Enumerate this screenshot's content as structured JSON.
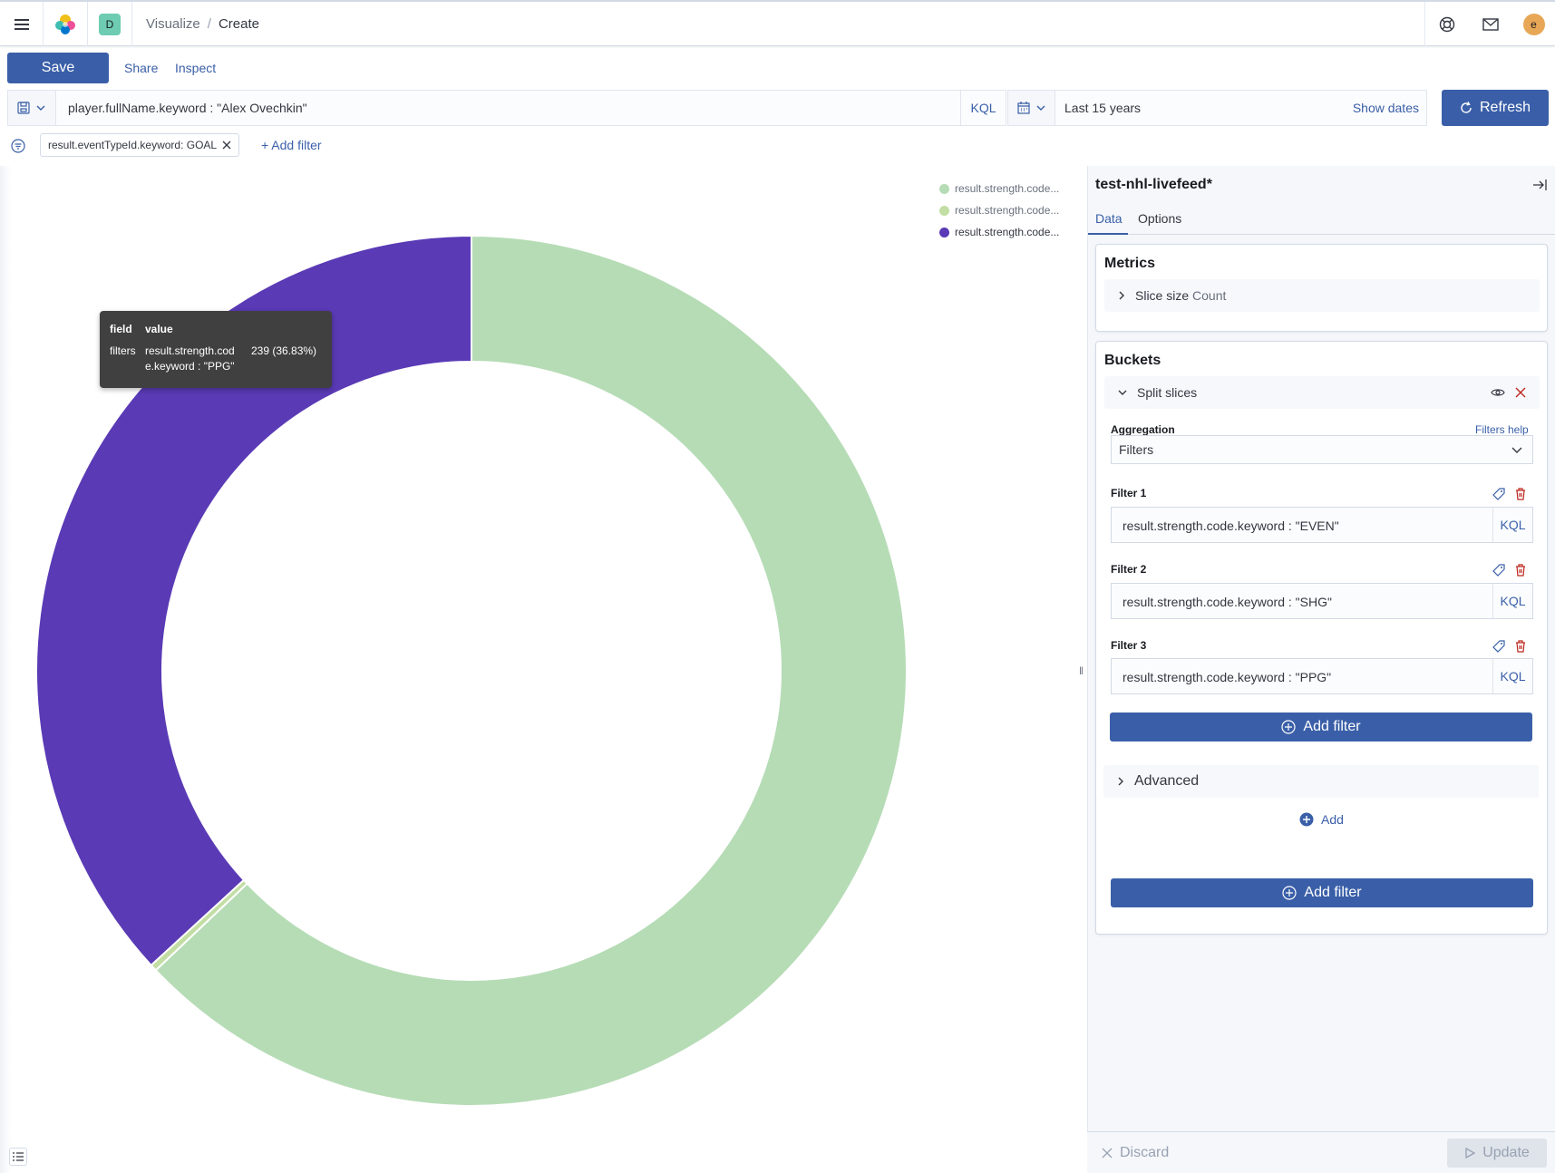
{
  "header": {
    "space_initial": "D",
    "breadcrumbs": [
      "Visualize",
      "Create"
    ],
    "breadcrumb_sep": "/",
    "avatar_initial": "e",
    "icons": {
      "menu": "hamburger-icon",
      "logo": "elastic-logo",
      "help": "help-icon",
      "mail": "mail-icon"
    }
  },
  "actions": {
    "save": "Save",
    "share": "Share",
    "inspect": "Inspect"
  },
  "query": {
    "text": "player.fullName.keyword : \"Alex Ovechkin\"",
    "language": "KQL"
  },
  "time": {
    "range": "Last 15 years",
    "show_dates": "Show dates",
    "refresh": "Refresh"
  },
  "filters": {
    "pills": [
      "result.eventTypeId.keyword: GOAL"
    ],
    "add_filter": "+ Add filter"
  },
  "chart_data": {
    "type": "pie",
    "donut": true,
    "legend_position": "top-right",
    "legend": [
      {
        "label": "result.strength.code...",
        "color": "#b6dcb6"
      },
      {
        "label": "result.strength.code...",
        "color": "#c3dea4"
      },
      {
        "label": "result.strength.code...",
        "color": "#5a3ab5"
      }
    ],
    "slices": [
      {
        "name": "result.strength.code.keyword : \"EVEN\"",
        "color": "#b6dcb6",
        "fraction": 0.6292
      },
      {
        "name": "result.strength.code.keyword : \"SHG\"",
        "color": "#c3dea4",
        "fraction": 0.0025
      },
      {
        "name": "result.strength.code.keyword : \"PPG\"",
        "value": 239,
        "percent": 36.83,
        "color": "#5a3ab5",
        "fraction": 0.3683
      }
    ]
  },
  "tooltip": {
    "header_field": "field",
    "header_value": "value",
    "field": "filters",
    "value_line1": "result.strength.cod",
    "value_line2": "e.keyword : \"PPG\"",
    "count": "239 (36.83%)"
  },
  "sidebar": {
    "index_pattern": "test-nhl-livefeed*",
    "tabs": [
      "Data",
      "Options"
    ],
    "metrics": {
      "title": "Metrics",
      "item_label": "Slice size",
      "item_value": "Count"
    },
    "buckets": {
      "title": "Buckets",
      "split_label": "Split slices",
      "aggregation_label": "Aggregation",
      "filters_help": "Filters help",
      "aggregation_value": "Filters",
      "filters": [
        {
          "label": "Filter 1",
          "query": "result.strength.code.keyword : \"EVEN\"",
          "lang": "KQL"
        },
        {
          "label": "Filter 2",
          "query": "result.strength.code.keyword : \"SHG\"",
          "lang": "KQL"
        },
        {
          "label": "Filter 3",
          "query": "result.strength.code.keyword : \"PPG\"",
          "lang": "KQL"
        }
      ],
      "add_filter": "Add filter",
      "advanced": "Advanced",
      "add": "Add"
    },
    "footer": {
      "discard": "Discard",
      "update": "Update"
    }
  }
}
